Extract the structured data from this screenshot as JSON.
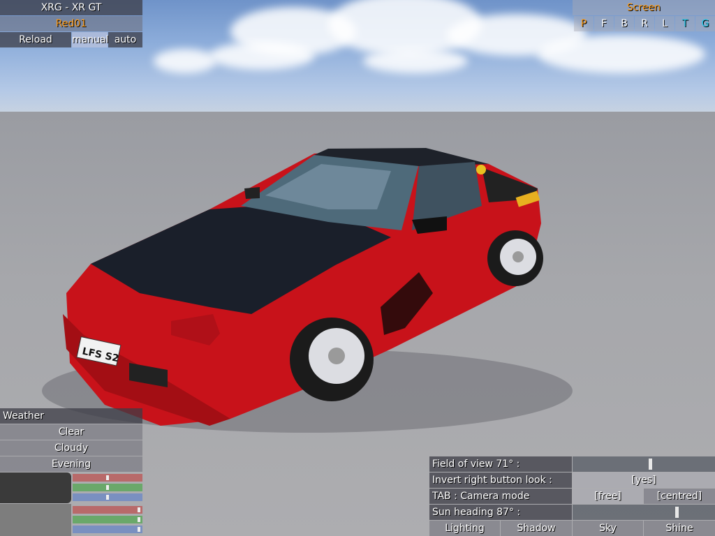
{
  "car": {
    "title": "XRG - XR GT",
    "skin": "Red01",
    "reload_label": "Reload",
    "manual_label": "manual",
    "auto_label": "auto",
    "plate_text": "LFS S2"
  },
  "screen_panel": {
    "title": "Screen",
    "buttons": [
      {
        "label": "P",
        "color": "#ffa020"
      },
      {
        "label": "F",
        "color": "#ffffff"
      },
      {
        "label": "B",
        "color": "#ffffff"
      },
      {
        "label": "R",
        "color": "#ffffff"
      },
      {
        "label": "L",
        "color": "#ffffff"
      },
      {
        "label": "T",
        "color": "#22c8e8"
      },
      {
        "label": "G",
        "color": "#22c8e8"
      }
    ]
  },
  "weather": {
    "title": "Weather",
    "options": [
      "Clear",
      "Cloudy",
      "Evening"
    ],
    "rgb_bars_top": {
      "r": 0.5,
      "g": 0.5,
      "b": 0.5
    },
    "rgb_bars_bottom": {
      "r": 0.97,
      "g": 0.97,
      "b": 0.97
    },
    "swatch_color_top": "#3a3a3a",
    "swatch_color_bottom": "#7d7d7d"
  },
  "view_settings": {
    "fov_label": "Field of view 71° :",
    "fov_value": 0.55,
    "invert_label": "Invert right button look :",
    "invert_value": "[yes]",
    "tab_label": "TAB : Camera mode",
    "camera_free": "[free]",
    "camera_centred": "[centred]",
    "sun_label": "Sun heading 87° :",
    "sun_value": 0.74,
    "tabs": [
      "Lighting",
      "Shadow",
      "Sky",
      "Shine"
    ]
  }
}
